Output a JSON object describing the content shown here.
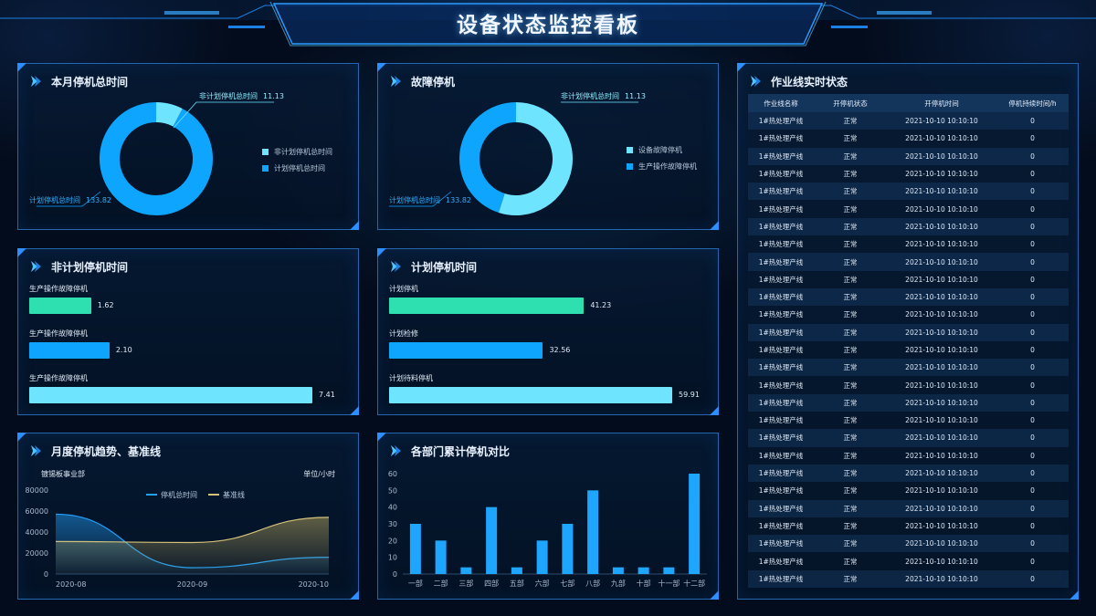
{
  "header": {
    "title": "设备状态监控看板"
  },
  "colors": {
    "cyan": "#6fe4ff",
    "blue": "#0ea5ff",
    "green": "#2ee0b0",
    "gold": "#d4c27a"
  },
  "panel_monthly_total": {
    "title": "本月停机总时间",
    "donut": [
      {
        "label": "非计划停机总时间",
        "value": 11.13,
        "color": "#6fe4ff"
      },
      {
        "label": "计划停机总时间",
        "value": 133.82,
        "color": "#0ea5ff"
      }
    ],
    "ann_top": {
      "label": "非计划停机总时间",
      "value": "11.13"
    },
    "ann_bottom": {
      "label": "计划停机总时间",
      "value": "133.82"
    },
    "legend": [
      "非计划停机总时间",
      "计划停机总时间"
    ]
  },
  "panel_fault": {
    "title": "故障停机",
    "donut": [
      {
        "label": "设备故障停机",
        "value": 55,
        "color": "#6fe4ff"
      },
      {
        "label": "生产操作故障停机",
        "value": 45,
        "color": "#0ea5ff"
      }
    ],
    "ann_top": {
      "label": "非计划停机总时间",
      "value": "11.13"
    },
    "ann_bottom": {
      "label": "计划停机总时间",
      "value": "133.82"
    },
    "legend": [
      "设备故障停机",
      "生产操作故障停机"
    ]
  },
  "panel_unplanned": {
    "title": "非计划停机时间",
    "bars": [
      {
        "label": "生产操作故障停机",
        "value": "1.62",
        "num": 1.62,
        "color": "#2ee0b0"
      },
      {
        "label": "生产操作故障停机",
        "value": "2.10",
        "num": 2.1,
        "color": "#0ea5ff"
      },
      {
        "label": "生产操作故障停机",
        "value": "7.41",
        "num": 7.41,
        "color": "#6fe4ff"
      }
    ]
  },
  "panel_planned": {
    "title": "计划停机时间",
    "bars": [
      {
        "label": "计划停机",
        "value": "41.23",
        "num": 41.23,
        "color": "#2ee0b0"
      },
      {
        "label": "计划检修",
        "value": "32.56",
        "num": 32.56,
        "color": "#0ea5ff"
      },
      {
        "label": "计划待料停机",
        "value": "59.91",
        "num": 59.91,
        "color": "#6fe4ff"
      }
    ]
  },
  "panel_trend": {
    "title": "月度停机趋势、基准线",
    "subtitle": "镀锡板事业部",
    "unit": "单位/小时",
    "legend": [
      "停机总时间",
      "基准线"
    ]
  },
  "panel_departments": {
    "title": "各部门累计停机对比"
  },
  "panel_line_status": {
    "title": "作业线实时状态",
    "columns": [
      "作业线名称",
      "开停机状态",
      "开停机时间",
      "停机持续时间/h"
    ],
    "rows": [
      [
        "1#热处理产线",
        "正常",
        "2021-10-10 10:10:10",
        "0"
      ],
      [
        "1#热处理产线",
        "正常",
        "2021-10-10 10:10:10",
        "0"
      ],
      [
        "1#热处理产线",
        "正常",
        "2021-10-10 10:10:10",
        "0"
      ],
      [
        "1#热处理产线",
        "正常",
        "2021-10-10 10:10:10",
        "0"
      ],
      [
        "1#热处理产线",
        "正常",
        "2021-10-10 10:10:10",
        "0"
      ],
      [
        "1#热处理产线",
        "正常",
        "2021-10-10 10:10:10",
        "0"
      ],
      [
        "1#热处理产线",
        "正常",
        "2021-10-10 10:10:10",
        "0"
      ],
      [
        "1#热处理产线",
        "正常",
        "2021-10-10 10:10:10",
        "0"
      ],
      [
        "1#热处理产线",
        "正常",
        "2021-10-10 10:10:10",
        "0"
      ],
      [
        "1#热处理产线",
        "正常",
        "2021-10-10 10:10:10",
        "0"
      ],
      [
        "1#热处理产线",
        "正常",
        "2021-10-10 10:10:10",
        "0"
      ],
      [
        "1#热处理产线",
        "正常",
        "2021-10-10 10:10:10",
        "0"
      ],
      [
        "1#热处理产线",
        "正常",
        "2021-10-10 10:10:10",
        "0"
      ],
      [
        "1#热处理产线",
        "正常",
        "2021-10-10 10:10:10",
        "0"
      ],
      [
        "1#热处理产线",
        "正常",
        "2021-10-10 10:10:10",
        "0"
      ],
      [
        "1#热处理产线",
        "正常",
        "2021-10-10 10:10:10",
        "0"
      ],
      [
        "1#热处理产线",
        "正常",
        "2021-10-10 10:10:10",
        "0"
      ],
      [
        "1#热处理产线",
        "正常",
        "2021-10-10 10:10:10",
        "0"
      ],
      [
        "1#热处理产线",
        "正常",
        "2021-10-10 10:10:10",
        "0"
      ],
      [
        "1#热处理产线",
        "正常",
        "2021-10-10 10:10:10",
        "0"
      ],
      [
        "1#热处理产线",
        "正常",
        "2021-10-10 10:10:10",
        "0"
      ],
      [
        "1#热处理产线",
        "正常",
        "2021-10-10 10:10:10",
        "0"
      ],
      [
        "1#热处理产线",
        "正常",
        "2021-10-10 10:10:10",
        "0"
      ],
      [
        "1#热处理产线",
        "正常",
        "2021-10-10 10:10:10",
        "0"
      ],
      [
        "1#热处理产线",
        "正常",
        "2021-10-10 10:10:10",
        "0"
      ],
      [
        "1#热处理产线",
        "正常",
        "2021-10-10 10:10:10",
        "0"
      ],
      [
        "1#热处理产线",
        "正常",
        "2021-10-10 10:10:10",
        "0"
      ]
    ]
  },
  "chart_data": [
    {
      "type": "line",
      "title": "月度停机趋势、基准线",
      "x": [
        "2020-08",
        "2020-09",
        "2020-10"
      ],
      "ylim": [
        0,
        80000
      ],
      "yticks": [
        "80000",
        "60000",
        "40000",
        "20000",
        "0"
      ],
      "series": [
        {
          "name": "停机总时间",
          "values": [
            57000,
            6000,
            16000
          ],
          "color": "#1fa3ff"
        },
        {
          "name": "基准线",
          "values": [
            31000,
            30000,
            54000
          ],
          "color": "#d4c27a"
        }
      ]
    },
    {
      "type": "bar",
      "title": "各部门累计停机对比",
      "categories": [
        "一部",
        "二部",
        "三部",
        "四部",
        "五部",
        "六部",
        "七部",
        "八部",
        "九部",
        "十部",
        "十一部",
        "十二部"
      ],
      "values": [
        30,
        20,
        4,
        40,
        4,
        20,
        30,
        50,
        4,
        4,
        4,
        60
      ],
      "ylim": [
        0,
        60
      ],
      "yticks": [
        "60",
        "50",
        "40",
        "30",
        "20",
        "10",
        "0"
      ]
    }
  ]
}
